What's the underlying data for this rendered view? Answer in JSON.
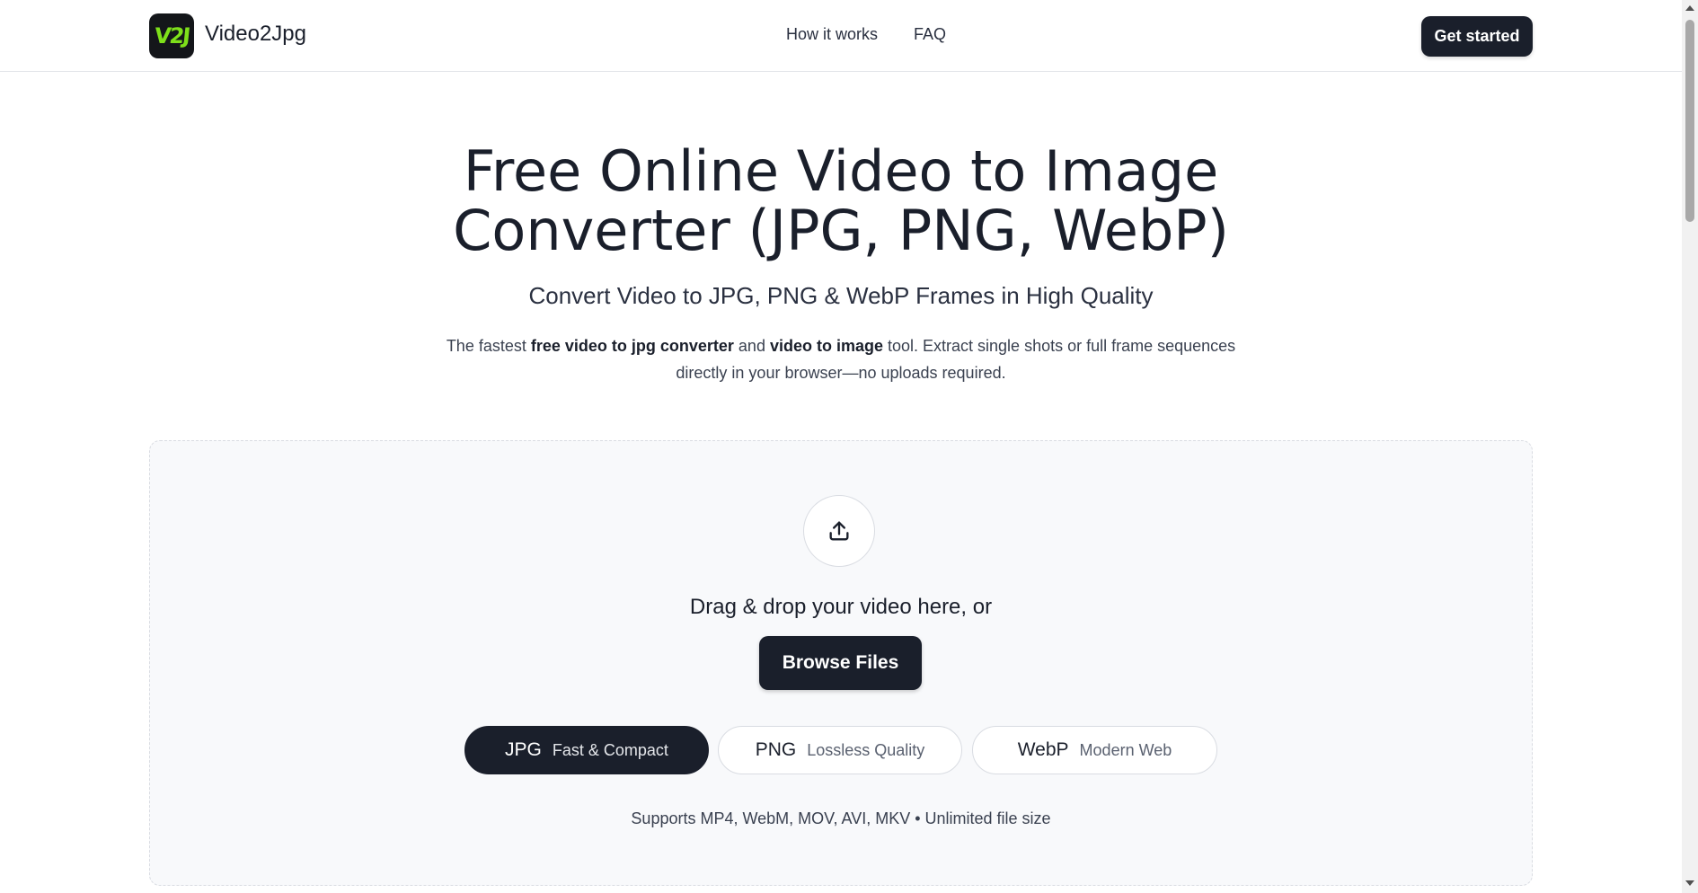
{
  "header": {
    "logo_text": "V2J",
    "brand": "Video2Jpg",
    "nav": [
      "How it works",
      "FAQ"
    ],
    "cta": "Get started"
  },
  "hero": {
    "title_line1": "Free Online Video to Image",
    "title_line2": "Converter (JPG, PNG, WebP)",
    "subtitle": "Convert Video to JPG, PNG & WebP Frames in High Quality",
    "desc_parts": [
      "The fastest ",
      "free video to jpg converter",
      " and ",
      "video to image",
      " tool. Extract single shots or full frame sequences directly in your browser—no uploads required."
    ]
  },
  "dropzone": {
    "icon": "upload-icon",
    "prompt": "Drag & drop your video here, or",
    "browse_label": "Browse Files",
    "formats": [
      {
        "name": "JPG",
        "desc": "Fast & Compact",
        "selected": true
      },
      {
        "name": "PNG",
        "desc": "Lossless Quality",
        "selected": false
      },
      {
        "name": "WebP",
        "desc": "Modern Web",
        "selected": false
      }
    ],
    "supports": "Supports MP4, WebM, MOV, AVI, MKV • Unlimited file size"
  },
  "colors": {
    "primary_dark": "#1a1f2b",
    "logo_accent": "#7ee01a",
    "dropzone_bg": "#f8f9fb"
  }
}
